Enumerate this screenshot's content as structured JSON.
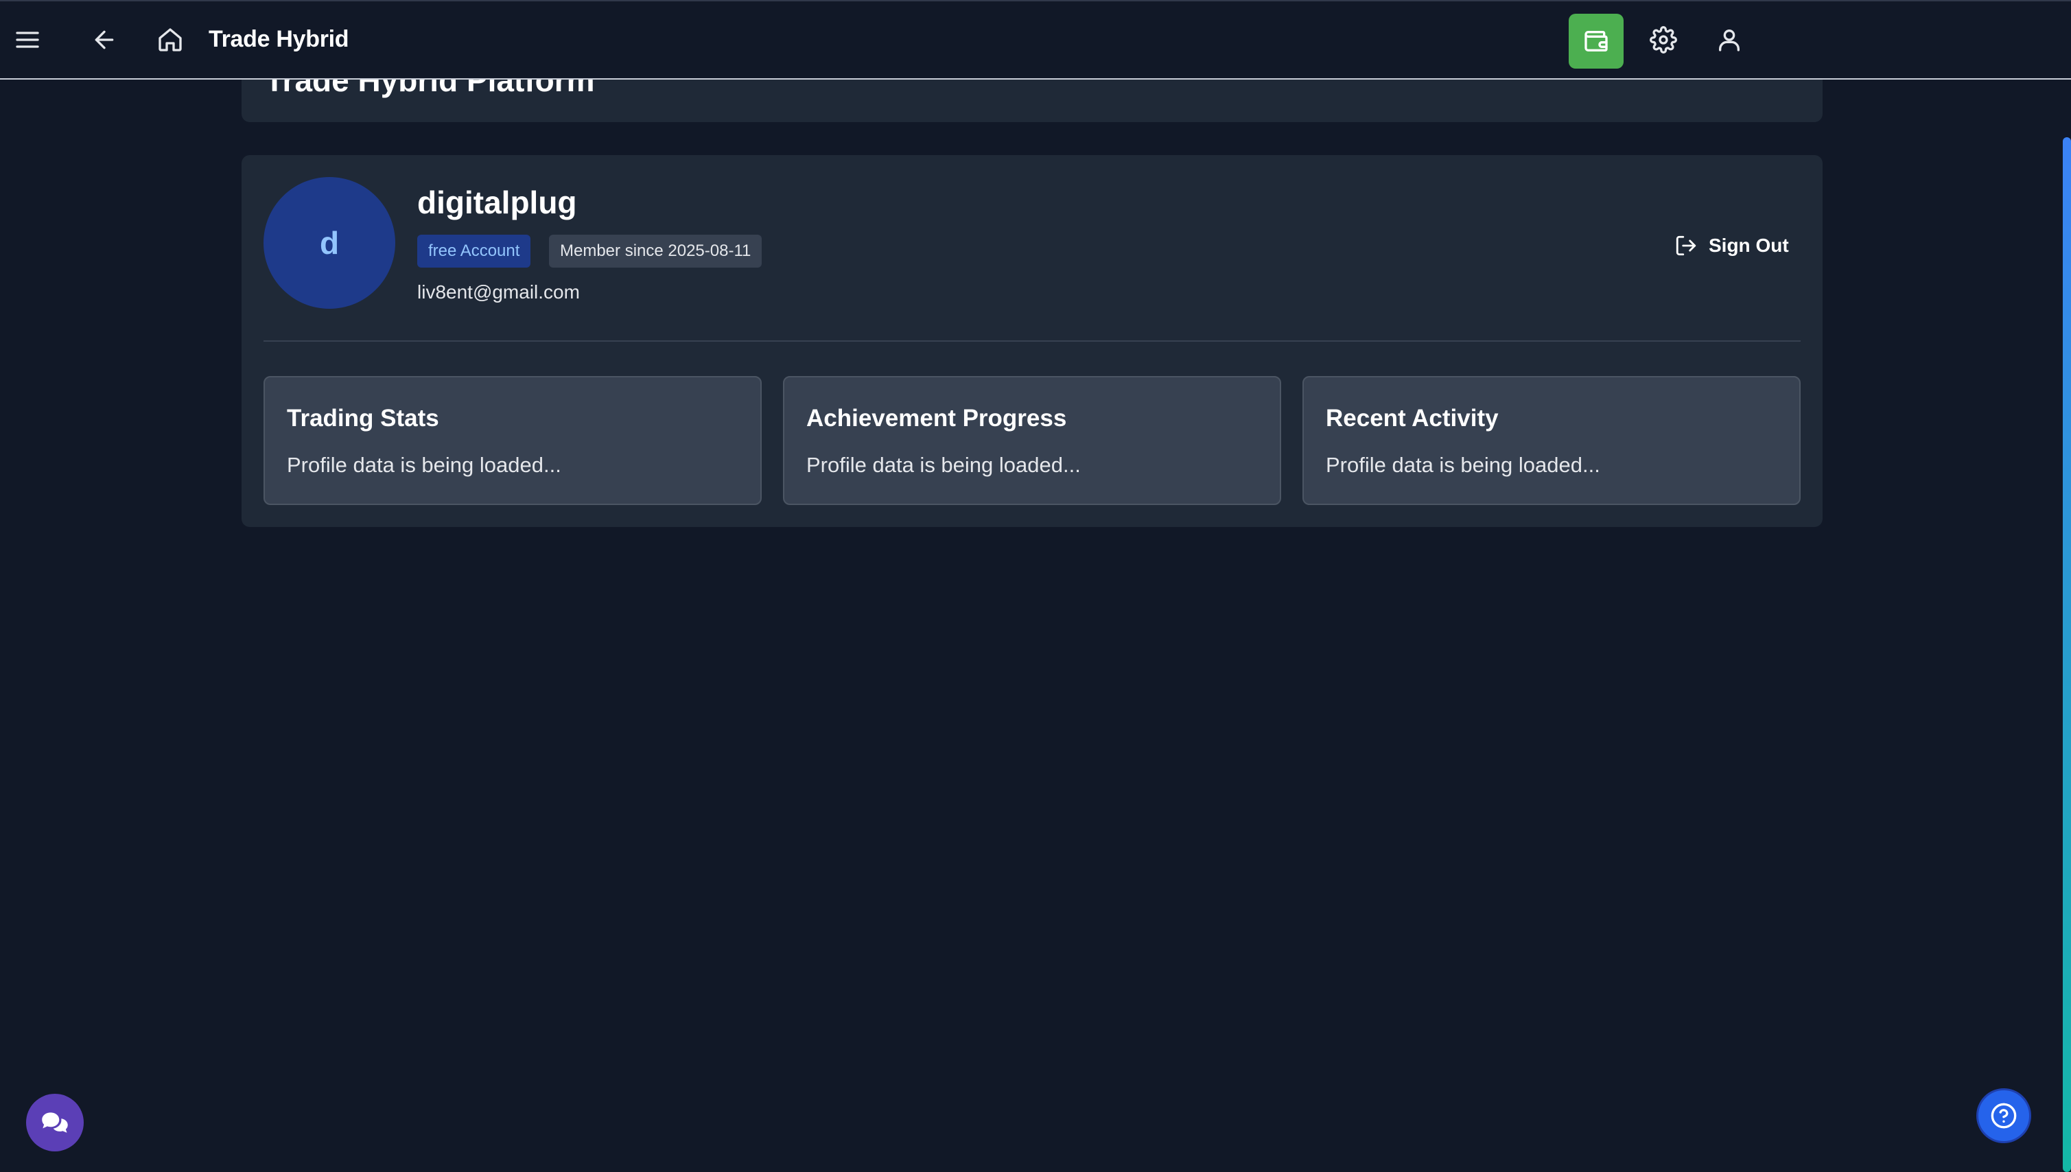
{
  "header": {
    "title": "Trade Hybrid",
    "icons": {
      "menu": "menu-icon",
      "back": "arrow-left-icon",
      "home": "home-icon",
      "wallet": "wallet-icon",
      "settings": "gear-icon",
      "user": "user-icon"
    },
    "wallet_color": "#4caf50"
  },
  "platform": {
    "title": "Trade Hybrid Platform"
  },
  "profile": {
    "avatar_initial": "d",
    "username": "digitalplug",
    "plan_badge": "free Account",
    "member_badge": "Member since 2025-08-11",
    "email": "liv8ent@gmail.com",
    "sign_out_label": "Sign Out"
  },
  "cards": [
    {
      "title": "Trading Stats",
      "text": "Profile data is being loaded..."
    },
    {
      "title": "Achievement Progress",
      "text": "Profile data is being loaded..."
    },
    {
      "title": "Recent Activity",
      "text": "Profile data is being loaded..."
    }
  ],
  "floating": {
    "chat_icon": "chat-bubbles-icon",
    "help_icon": "help-circle-icon"
  },
  "colors": {
    "background": "#111827",
    "card": "#1f2937",
    "inner_card": "#374151",
    "avatar": "#1e3a8a",
    "chat_button": "#5b3fb6",
    "help_button": "#2563eb"
  }
}
